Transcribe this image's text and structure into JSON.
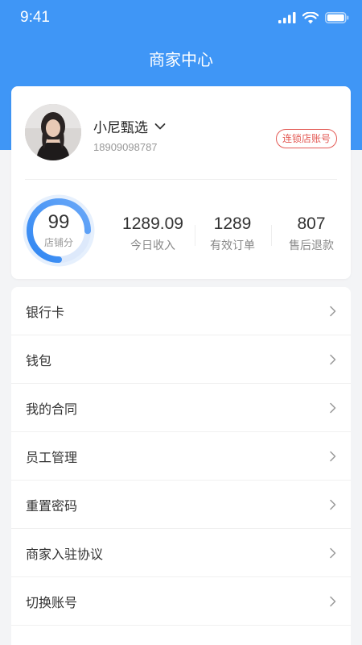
{
  "status_bar": {
    "time": "9:41",
    "icons": [
      "signal-icon",
      "wifi-icon",
      "battery-icon"
    ]
  },
  "header": {
    "title": "商家中心",
    "background_color": "#3f96f6"
  },
  "profile": {
    "shop_name": "小尼甄选",
    "phone": "18909098787",
    "badge": "连锁店账号",
    "badge_color": "#e35a55"
  },
  "stats": {
    "score": {
      "value": "99",
      "label": "店铺分",
      "ring_fill": 0.75
    },
    "income": {
      "value": "1289.09",
      "label": "今日收入"
    },
    "orders": {
      "value": "1289",
      "label": "有效订单"
    },
    "refunds": {
      "value": "807",
      "label": "售后退款"
    }
  },
  "menu": {
    "items": [
      {
        "label": "银行卡"
      },
      {
        "label": "钱包"
      },
      {
        "label": "我的合同"
      },
      {
        "label": "员工管理"
      },
      {
        "label": "重置密码"
      },
      {
        "label": "商家入驻协议"
      },
      {
        "label": "切换账号"
      }
    ]
  }
}
